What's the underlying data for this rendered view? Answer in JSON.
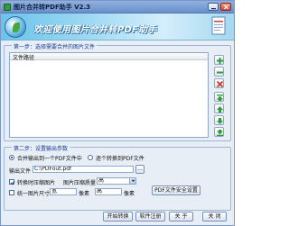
{
  "window": {
    "title": "图片合并转PDF助手 V2.3",
    "banner": "欢迎使用图片合并转PDF助手"
  },
  "step1": {
    "title": "第一步：选择需要合并的图片文件",
    "column_header": "文件路径",
    "side_icons": [
      "add-file-icon",
      "remove-file-icon",
      "clear-list-icon",
      "move-top-icon",
      "move-up-icon",
      "move-down-icon",
      "move-bottom-icon"
    ]
  },
  "step2": {
    "title": "第二步：设置输出参数",
    "mode_merge": "合并输出到一个PDF文件中",
    "mode_each": "逐个转换到PDF文件",
    "output_label": "输出文件",
    "output_value": "C:\\PDFout.pdf",
    "browse_label": "...",
    "compress_label": "转换时压缩图片",
    "quality_label": "图片压缩质量",
    "quality_value": "高",
    "uniform_size_label": "统一图片尺寸",
    "width_value": "宽",
    "width_unit": "像素",
    "height_value": "高",
    "height_unit": "像素",
    "security_button": "PDF文件安全设置"
  },
  "footer": {
    "start": "开始转换",
    "register": "软件注册",
    "about": "关 于",
    "close": "关 闭"
  },
  "colors": {
    "accent": "#1a3d8f",
    "group_border": "#9fb4d2",
    "add_green": "#2f9b3b",
    "remove_red": "#d23a2a"
  }
}
